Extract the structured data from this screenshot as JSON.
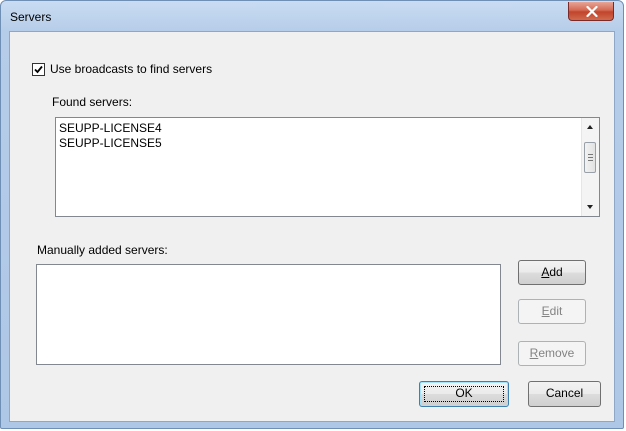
{
  "window": {
    "title": "Servers"
  },
  "broadcast": {
    "label": "Use broadcasts to find servers",
    "checked": true
  },
  "found": {
    "label": "Found servers:",
    "items": [
      "SEUPP-LICENSE4",
      "SEUPP-LICENSE5"
    ]
  },
  "manual": {
    "label": "Manually added servers:",
    "items": []
  },
  "buttons": {
    "add": {
      "accel": "A",
      "rest": "dd"
    },
    "edit": {
      "accel": "E",
      "rest": "dit"
    },
    "remove": {
      "accel": "R",
      "rest": "emove"
    },
    "ok": "OK",
    "cancel": "Cancel"
  },
  "icons": {
    "close": "close-icon",
    "check": "checkmark-icon"
  }
}
